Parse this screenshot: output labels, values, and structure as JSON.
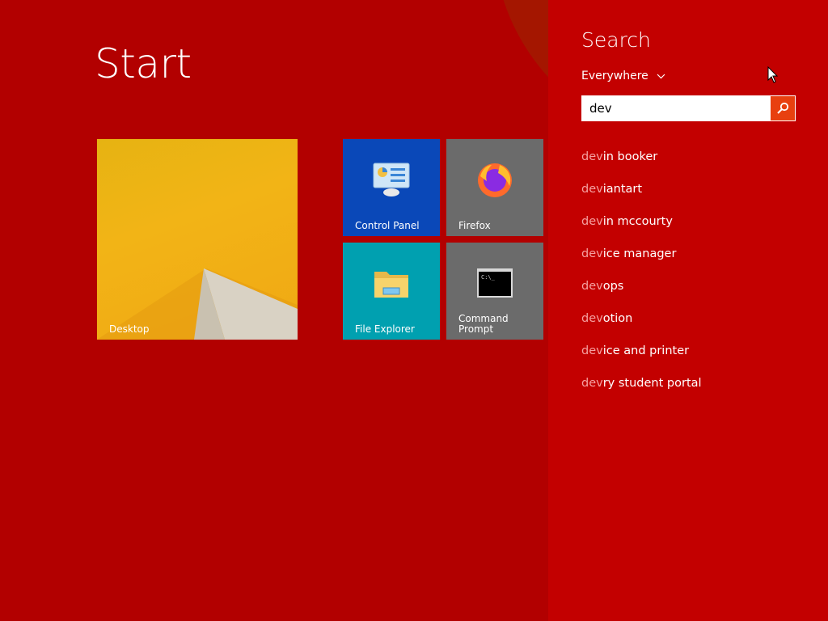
{
  "start": {
    "title": "Start"
  },
  "tiles": [
    {
      "label": "Desktop",
      "icon": "desktop-wallpaper"
    },
    {
      "label": "Control Panel",
      "icon": "control-panel-icon"
    },
    {
      "label": "Firefox",
      "icon": "firefox-icon"
    },
    {
      "label": "File Explorer",
      "icon": "folder-icon"
    },
    {
      "label": "Command\nPrompt",
      "icon": "command-prompt-icon"
    }
  ],
  "search": {
    "heading": "Search",
    "scope": "Everywhere",
    "query": "dev",
    "suggestions": [
      {
        "match": "dev",
        "rest": "in booker"
      },
      {
        "match": "dev",
        "rest": "iantart"
      },
      {
        "match": "dev",
        "rest": "in mccourty"
      },
      {
        "match": "dev",
        "rest": "ice manager"
      },
      {
        "match": "dev",
        "rest": "ops"
      },
      {
        "match": "dev",
        "rest": "otion"
      },
      {
        "match": "dev",
        "rest": "ice and printer"
      },
      {
        "match": "dev",
        "rest": "ry student portal"
      }
    ]
  },
  "colors": {
    "background": "#b20000",
    "search_pane": "#c30000",
    "search_button": "#e8400f",
    "control_panel_tile": "#0a48b8",
    "explorer_tile": "#00a0b0",
    "gray_tile": "#6b6b6b",
    "desktop_tile": "#f2b416"
  }
}
